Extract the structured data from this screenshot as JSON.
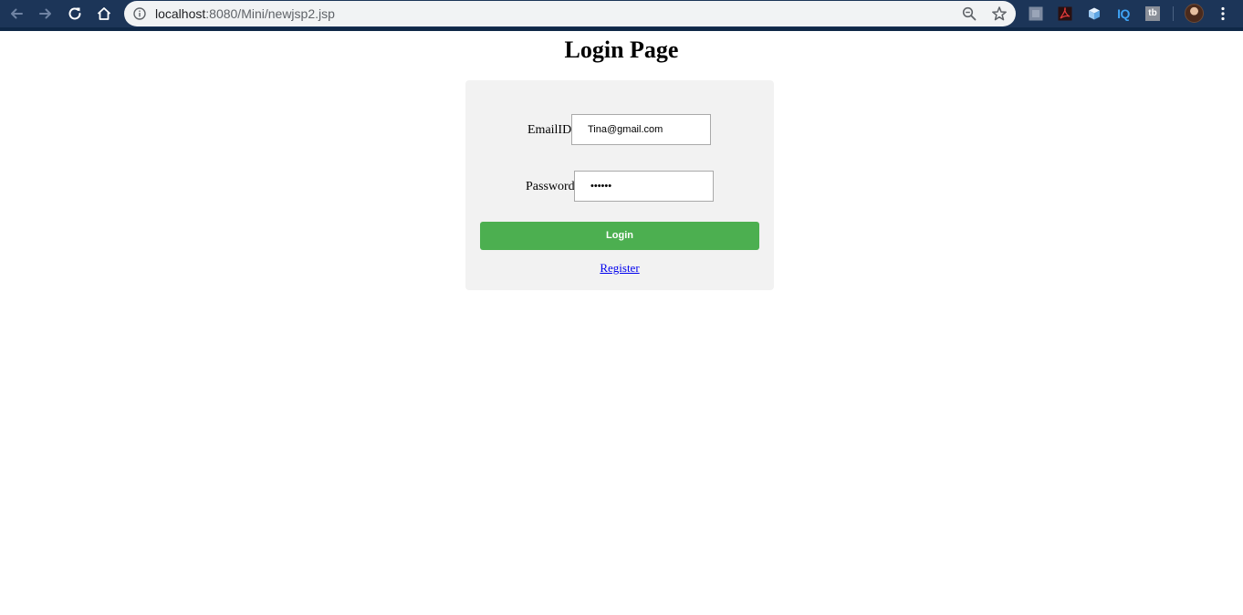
{
  "browser": {
    "url_host": "localhost",
    "url_rest": ":8080/Mini/newjsp2.jsp",
    "icons": {
      "back": "back-arrow-icon",
      "forward": "forward-arrow-icon",
      "reload": "reload-icon",
      "home": "home-icon",
      "info": "info-icon",
      "zoom": "zoom-out-icon",
      "bookmark": "star-icon",
      "menu": "kebab-menu-icon"
    },
    "extensions": [
      {
        "name": "gray-square-extension-icon"
      },
      {
        "name": "pdf-extension-icon"
      },
      {
        "name": "cube-extension-icon"
      },
      {
        "name": "iq-extension-icon",
        "label": "IQ"
      },
      {
        "name": "tb-extension-icon",
        "label": "tb"
      }
    ],
    "colors": {
      "toolbar": "#1c3558",
      "omnibox": "#f1f3f4"
    }
  },
  "page": {
    "title": "Login Page",
    "form": {
      "email_label": "EmailID:",
      "email_value": "Tina@gmail.com",
      "password_label": "Password:",
      "password_value": "••••••",
      "login_label": "Login",
      "register_label": "Register"
    },
    "colors": {
      "card_background": "#f2f2f2",
      "login_button": "#4caf50",
      "link": "#0000ee"
    }
  }
}
